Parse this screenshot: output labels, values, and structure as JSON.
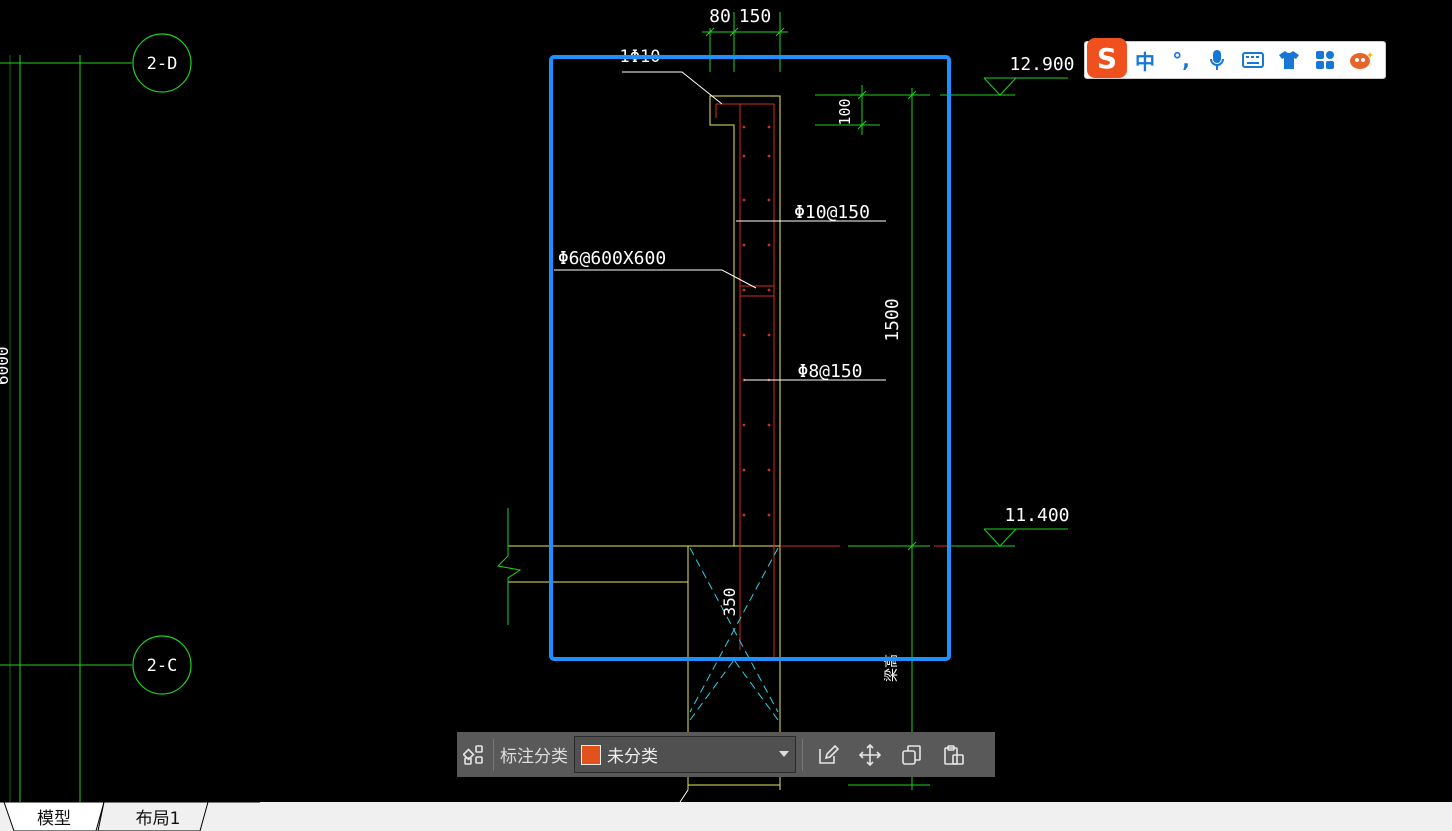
{
  "cad": {
    "grid_axes": [
      {
        "label": "2-D"
      },
      {
        "label": "2-C"
      }
    ],
    "left_dim_partial": "6000",
    "dimensions": {
      "top_left": "80",
      "top_right": "150",
      "lip": "100",
      "height": "1500",
      "beam": "350"
    },
    "rebar_labels": {
      "top_bar": "1Φ10",
      "horizontal": "Φ10@150",
      "tie": "Φ6@600X600",
      "vertical": "Φ8@150"
    },
    "elevations": {
      "top": "12.900",
      "bottom": "11.400"
    },
    "side_partial": "梁高"
  },
  "ime": {
    "logo": "S",
    "lang": "中",
    "punct": "°,",
    "voice_icon": "microphone-icon",
    "keyboard_icon": "keyboard-icon",
    "skin_icon": "shirt-icon",
    "toolbox_icon": "apps-icon",
    "mascot_icon": "mascot-icon"
  },
  "toolbar": {
    "label": "标注分类",
    "category": "未分类",
    "swatch_color": "#e2521d"
  },
  "tabs": [
    {
      "label": "模型",
      "active": true
    },
    {
      "label": "布局1",
      "active": false
    }
  ],
  "colors": {
    "background": "#000000",
    "grid_green": "#1fd11f",
    "outline_yellow": "#e8e85a",
    "rebar_red": "#d42a2a",
    "hatch_cyan": "#2ad4e8",
    "selection_blue": "#1e90ff"
  }
}
